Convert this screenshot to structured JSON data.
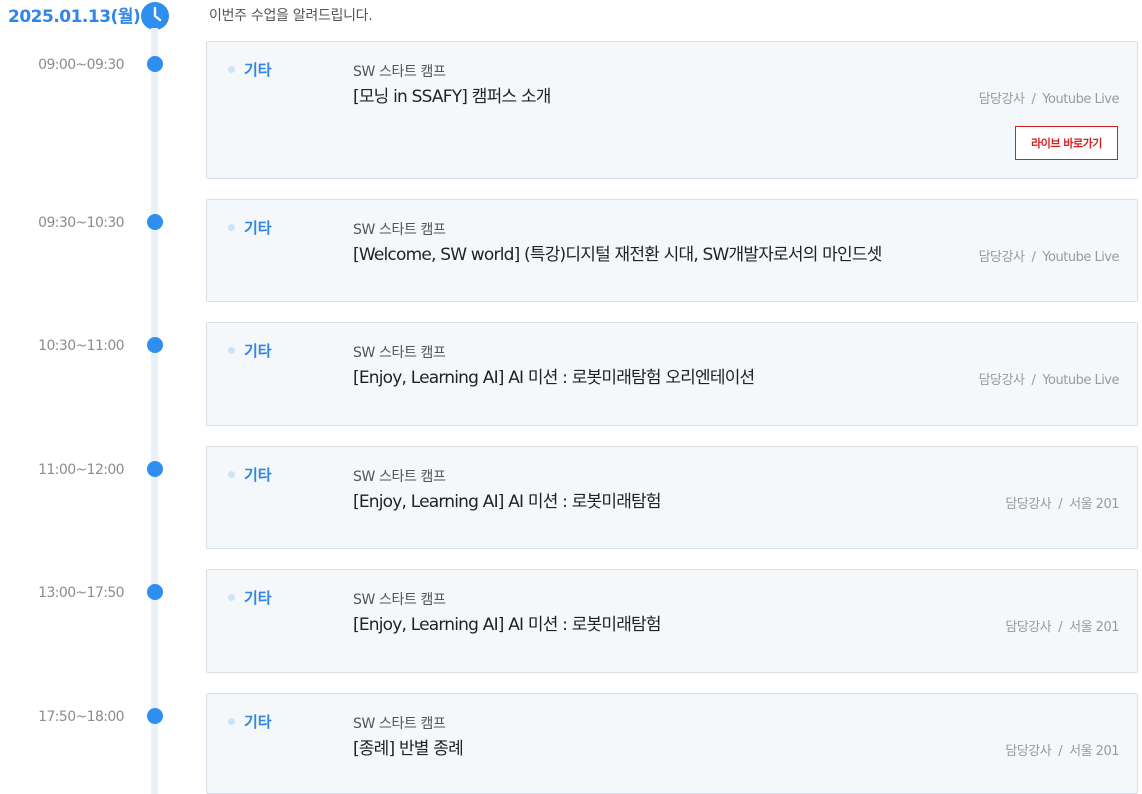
{
  "header": {
    "date": "2025.01.13(월)",
    "intro": "이번주 수업을 알려드립니다."
  },
  "icons": {
    "clock": "clock-icon"
  },
  "colors": {
    "accent": "#2f86e8",
    "timeline": "#e8f0f8",
    "card_bg": "#f5f8fb",
    "live_button": "#d81f1f"
  },
  "sessions": [
    {
      "time": "09:00~09:30",
      "category": "기타",
      "course": "SW 스타트 캠프",
      "title": "[모닝 in SSAFY] 캠퍼스 소개",
      "instructor": "담당강사",
      "location": "Youtube Live",
      "live_button": "라이브 바로가기"
    },
    {
      "time": "09:30~10:30",
      "category": "기타",
      "course": "SW 스타트 캠프",
      "title": "[Welcome, SW world] (특강)디지털 재전환 시대, SW개발자로서의 마인드셋",
      "instructor": "담당강사",
      "location": "Youtube Live"
    },
    {
      "time": "10:30~11:00",
      "category": "기타",
      "course": "SW 스타트 캠프",
      "title": "[Enjoy, Learning AI] AI 미션 : 로봇미래탐험 오리엔테이션",
      "instructor": "담당강사",
      "location": "Youtube Live"
    },
    {
      "time": "11:00~12:00",
      "category": "기타",
      "course": "SW 스타트 캠프",
      "title": "[Enjoy, Learning AI] AI 미션 : 로봇미래탐험",
      "instructor": "담당강사",
      "location": "서울 201"
    },
    {
      "time": "13:00~17:50",
      "category": "기타",
      "course": "SW 스타트 캠프",
      "title": "[Enjoy, Learning AI] AI 미션 : 로봇미래탐험",
      "instructor": "담당강사",
      "location": "서울 201"
    },
    {
      "time": "17:50~18:00",
      "category": "기타",
      "course": "SW 스타트 캠프",
      "title": "[종례] 반별 종례",
      "instructor": "담당강사",
      "location": "서울 201"
    }
  ]
}
